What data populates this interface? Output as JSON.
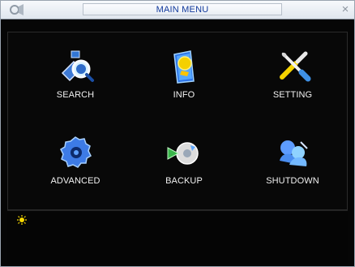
{
  "window": {
    "title": "MAIN MENU",
    "app_icon": "camera-icon",
    "close_icon": "close-icon"
  },
  "menu": {
    "items": [
      {
        "label": "SEARCH",
        "icon": "search-icon"
      },
      {
        "label": "INFO",
        "icon": "info-icon"
      },
      {
        "label": "SETTING",
        "icon": "setting-icon"
      },
      {
        "label": "ADVANCED",
        "icon": "advanced-icon"
      },
      {
        "label": "BACKUP",
        "icon": "backup-icon"
      },
      {
        "label": "SHUTDOWN",
        "icon": "shutdown-icon"
      }
    ]
  },
  "hint": {
    "icon": "sun-icon",
    "text": ""
  },
  "colors": {
    "title_text": "#123a9c",
    "background": "#060606",
    "label_text": "#f1f1f1",
    "accent_blue": "#2e6fe0",
    "accent_yellow": "#f5d300"
  }
}
